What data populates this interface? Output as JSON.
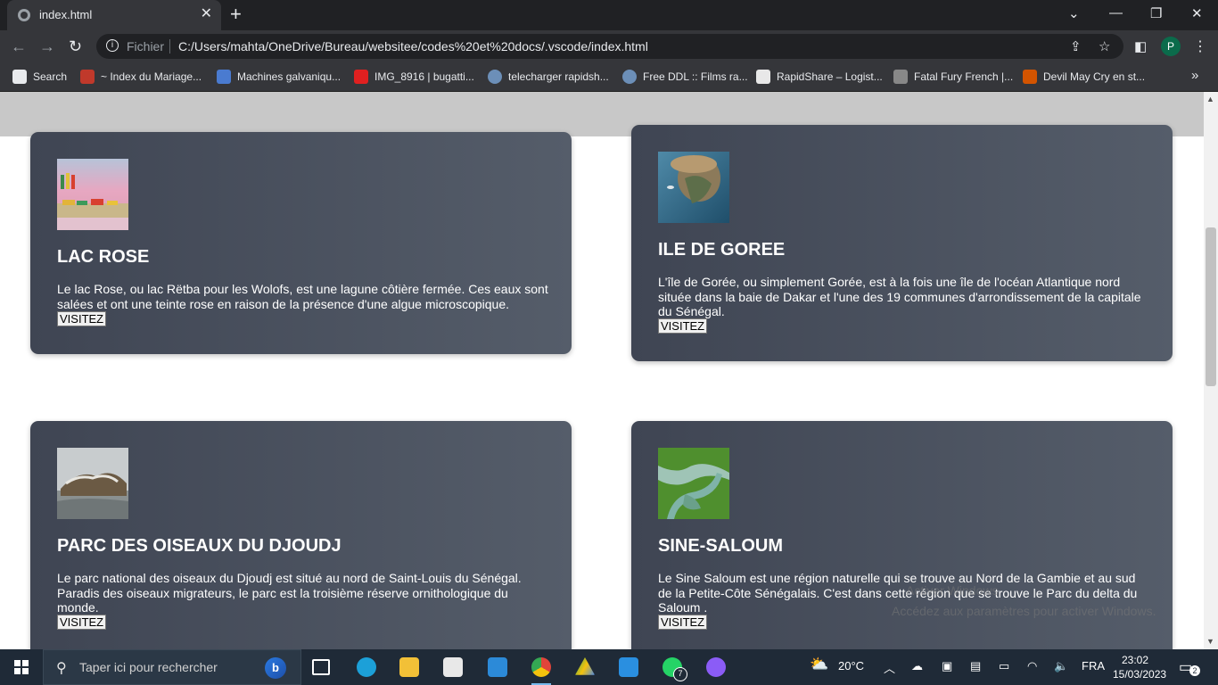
{
  "browser": {
    "tab_title": "index.html",
    "tab_close": "✕",
    "new_tab": "+",
    "url_scheme": "Fichier",
    "url": "C:/Users/mahta/OneDrive/Bureau/websitee/codes%20et%20docs/.vscode/index.html",
    "profile_initial": "P",
    "window_controls": {
      "dropdown": "⌄",
      "minimize": "—",
      "restore": "❐",
      "close": "✕"
    },
    "bookmarks": [
      {
        "label": "Search",
        "icon": "search-icon",
        "color": "#e8eaed"
      },
      {
        "label": "~ Index du Mariage...",
        "icon": "bookmark-favicon",
        "color": "#c0392b"
      },
      {
        "label": "Machines galvaniqu...",
        "icon": "bookmark-favicon",
        "color": "#4a7bd0"
      },
      {
        "label": "IMG_8916 | bugatti...",
        "icon": "bookmark-favicon",
        "color": "#e02020"
      },
      {
        "label": "telecharger rapidsh...",
        "icon": "globe-icon",
        "color": "#6c8fb8"
      },
      {
        "label": "Free DDL :: Films ra...",
        "icon": "globe-icon",
        "color": "#6c8fb8"
      },
      {
        "label": "RapidShare – Logist...",
        "icon": "bookmark-favicon",
        "color": "#e8e8e8"
      },
      {
        "label": "Fatal Fury French |...",
        "icon": "bookmark-favicon",
        "color": "#888888"
      },
      {
        "label": "Devil May Cry en st...",
        "icon": "bookmark-favicon",
        "color": "#d35400"
      }
    ],
    "bookmarks_more": "»"
  },
  "cards": [
    {
      "title": "LAC ROSE",
      "description": "Le lac Rose, ou lac Rëtba pour les Wolofs, est une lagune côtière fermée. Ces eaux sont salées et ont une teinte rose en raison de la présence d'une algue microscopique.",
      "button": "VISITEZ"
    },
    {
      "title": "ILE DE GOREE",
      "description": "L'île de Gorée, ou simplement Gorée, est à la fois une île de l'océan Atlantique nord située dans la baie de Dakar et l'une des 19 communes d'arrondissement de la capitale du Sénégal.",
      "button": "VISITEZ"
    },
    {
      "title": "PARC DES OISEAUX DU DJOUDJ",
      "description": "Le parc national des oiseaux du Djoudj est situé au nord de Saint-Louis du Sénégal. Paradis des oiseaux migrateurs, le parc est la troisième réserve ornithologique du monde.",
      "button": "VISITEZ"
    },
    {
      "title": "SINE-SALOUM",
      "description": "Le Sine Saloum est une région naturelle qui se trouve au Nord de la Gambie et au sud de la Petite-Côte Sénégalais. C'est dans cette région que se trouve le Parc du delta du Saloum .",
      "button": "VISITEZ"
    }
  ],
  "watermark": {
    "line1": "Activer Windows",
    "line2": "Accédez aux paramètres pour activer Windows."
  },
  "taskbar": {
    "search_placeholder": "Taper ici pour rechercher",
    "apps": [
      {
        "name": "task-view",
        "color": "#ffffff"
      },
      {
        "name": "edge",
        "color": "#1ca0d8"
      },
      {
        "name": "file-explorer",
        "color": "#f2c037"
      },
      {
        "name": "store",
        "color": "#e8e8e8"
      },
      {
        "name": "mail",
        "color": "#2c8ad8"
      },
      {
        "name": "chrome",
        "color": "#e0443a"
      },
      {
        "name": "google-drive",
        "color": "#34a853"
      },
      {
        "name": "vscode",
        "color": "#2a8fe0"
      },
      {
        "name": "whatsapp",
        "color": "#25d366"
      },
      {
        "name": "github-desktop",
        "color": "#8b5cf6"
      }
    ],
    "whatsapp_badge": "7",
    "weather": "20°C",
    "language": "FRA",
    "time": "23:02",
    "date": "15/03/2023",
    "notification_count": "2"
  }
}
